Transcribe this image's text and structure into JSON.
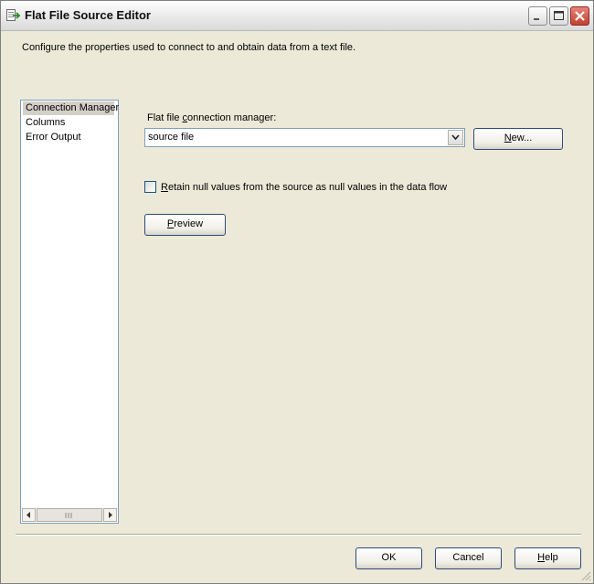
{
  "window": {
    "title": "Flat File Source Editor",
    "icons": {
      "app": "flat-file-source-icon",
      "minimize": "minimize-icon",
      "maximize": "maximize-icon",
      "close": "close-icon"
    }
  },
  "description": "Configure the properties used to connect to and obtain data from a text file.",
  "nav": {
    "items": [
      {
        "label": "Connection Manager",
        "selected": true
      },
      {
        "label": "Columns",
        "selected": false
      },
      {
        "label": "Error Output",
        "selected": false
      }
    ]
  },
  "connection": {
    "label_before": "Flat file ",
    "label_access": "c",
    "label_after": "onnection manager:",
    "value": "source file",
    "new_access": "N",
    "new_rest": "ew..."
  },
  "retain_nulls": {
    "access": "R",
    "rest": "etain null values from the source as null values in the data flow",
    "checked": false
  },
  "preview": {
    "access": "P",
    "rest": "review"
  },
  "footer": {
    "ok": "OK",
    "cancel": "Cancel",
    "help_access": "H",
    "help_rest": "elp"
  },
  "colors": {
    "dialog_bg": "#ece9d8",
    "border": "#7f9db9",
    "button_border": "#2f4b78"
  }
}
